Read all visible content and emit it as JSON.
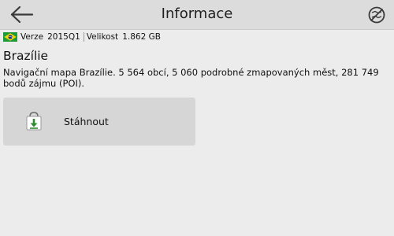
{
  "header": {
    "title": "Informace",
    "back_icon": "arrow-left-icon",
    "right_icon": "no-map-icon"
  },
  "meta": {
    "flag_icon": "brazil-flag-icon",
    "version_label": "Verze",
    "version_value": "2015Q1",
    "size_label": "Velikost",
    "size_value": "1.862 GB"
  },
  "map": {
    "name": "Brazílie",
    "description": "Navigační mapa Brazílie. 5 564 obcí, 5 060 podrobné zmapovaných měst, 281 749 bodů zájmu (POI)."
  },
  "actions": {
    "download_label": "Stáhnout",
    "download_icon": "download-bag-icon"
  },
  "colors": {
    "background": "#ececec",
    "header_bg": "#dcdcdc",
    "button_bg": "#d6d6d6",
    "download_green": "#2e8b2e"
  }
}
